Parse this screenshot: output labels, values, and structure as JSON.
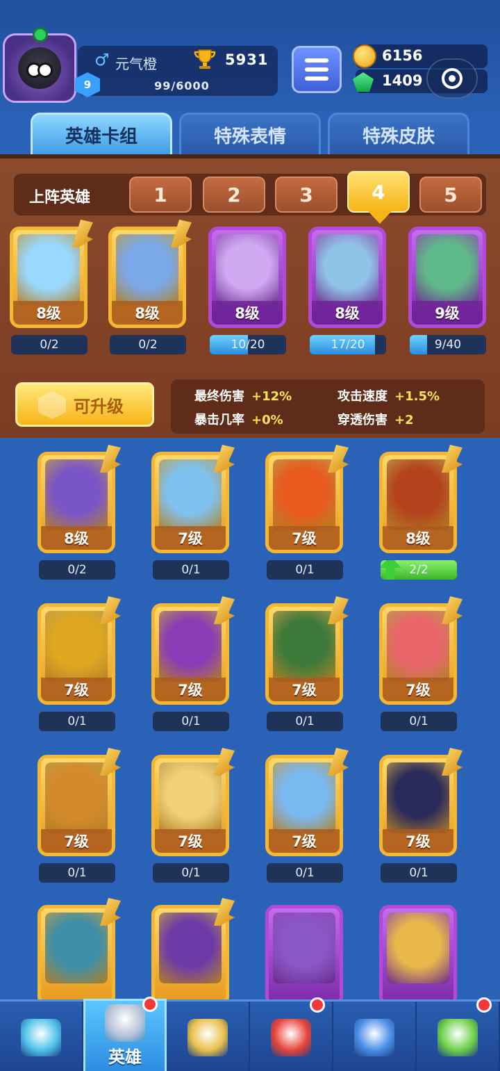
{
  "header": {
    "player_name": "元气橙",
    "trophies": "5931",
    "level": "9",
    "xp": "99/6000",
    "coins": "6156",
    "gems": "1409"
  },
  "tabs": [
    {
      "label": "英雄卡组",
      "active": true
    },
    {
      "label": "特殊表情",
      "active": false
    },
    {
      "label": "特殊皮肤",
      "active": false
    }
  ],
  "deck": {
    "title": "上阵英雄",
    "slots": [
      "1",
      "2",
      "3",
      "4",
      "5"
    ],
    "active_slot": "4",
    "cards": [
      {
        "level": "8级",
        "progress": "0/2",
        "frame": "gold",
        "fill": 0.0,
        "art": "#9ad8ff"
      },
      {
        "level": "8级",
        "progress": "0/2",
        "frame": "gold",
        "fill": 0.0,
        "art": "#7aa8e8"
      },
      {
        "level": "8级",
        "progress": "10/20",
        "frame": "purple",
        "fill": 0.5,
        "art": "#cfa9f2"
      },
      {
        "level": "8级",
        "progress": "17/20",
        "frame": "purple",
        "fill": 0.85,
        "art": "#8fc3e8"
      },
      {
        "level": "9级",
        "progress": "9/40",
        "frame": "purple",
        "fill": 0.225,
        "art": "#5fb98a"
      }
    ],
    "upgrade_label": "可升级",
    "stats": [
      {
        "label": "最终伤害",
        "value": "+12%"
      },
      {
        "label": "攻击速度",
        "value": "+1.5%"
      },
      {
        "label": "暴击几率",
        "value": "+0%"
      },
      {
        "label": "穿透伤害",
        "value": "+2"
      }
    ]
  },
  "collection": [
    {
      "level": "8级",
      "progress": "0/2",
      "frame": "gold",
      "fill": 0.0,
      "art": "#7a55c8"
    },
    {
      "level": "7级",
      "progress": "0/1",
      "frame": "gold",
      "fill": 0.0,
      "art": "#7fc2f0"
    },
    {
      "level": "7级",
      "progress": "0/1",
      "frame": "gold",
      "fill": 0.0,
      "art": "#e85a1e"
    },
    {
      "level": "8级",
      "progress": "2/2",
      "frame": "gold",
      "fill": 1.0,
      "art": "#b4421c",
      "upgradable": true
    },
    {
      "level": "7级",
      "progress": "0/1",
      "frame": "gold",
      "fill": 0.0,
      "art": "#e0a820"
    },
    {
      "level": "7级",
      "progress": "0/1",
      "frame": "gold",
      "fill": 0.0,
      "art": "#8a3bb5"
    },
    {
      "level": "7级",
      "progress": "0/1",
      "frame": "gold",
      "fill": 0.0,
      "art": "#3d7a3a"
    },
    {
      "level": "7级",
      "progress": "0/1",
      "frame": "gold",
      "fill": 0.0,
      "art": "#e8666a"
    },
    {
      "level": "7级",
      "progress": "0/1",
      "frame": "gold",
      "fill": 0.0,
      "art": "#d48a2a"
    },
    {
      "level": "7级",
      "progress": "0/1",
      "frame": "gold",
      "fill": 0.0,
      "art": "#f1d27a"
    },
    {
      "level": "7级",
      "progress": "0/1",
      "frame": "gold",
      "fill": 0.0,
      "art": "#7ab8f0"
    },
    {
      "level": "7级",
      "progress": "0/1",
      "frame": "gold",
      "fill": 0.0,
      "art": "#2a2a5a"
    },
    {
      "level": "",
      "progress": "",
      "frame": "gold",
      "fill": 0.0,
      "art": "#3d8fa8"
    },
    {
      "level": "",
      "progress": "",
      "frame": "gold",
      "fill": 0.0,
      "art": "#6d3aa8"
    },
    {
      "level": "",
      "progress": "",
      "frame": "purple",
      "fill": 0.0,
      "art": "#8a56c8"
    },
    {
      "level": "",
      "progress": "",
      "frame": "purple",
      "fill": 0.0,
      "art": "#e8b84a"
    }
  ],
  "bottom_nav": [
    {
      "name": "treasure-chest",
      "label": "",
      "active": false,
      "badge": false
    },
    {
      "name": "heroes",
      "label": "英雄",
      "active": true,
      "badge": true
    },
    {
      "name": "battle",
      "label": "",
      "active": false,
      "badge": false
    },
    {
      "name": "rank",
      "label": "",
      "active": false,
      "badge": true
    },
    {
      "name": "social",
      "label": "",
      "active": false,
      "badge": false
    },
    {
      "name": "garden",
      "label": "",
      "active": false,
      "badge": true
    }
  ]
}
